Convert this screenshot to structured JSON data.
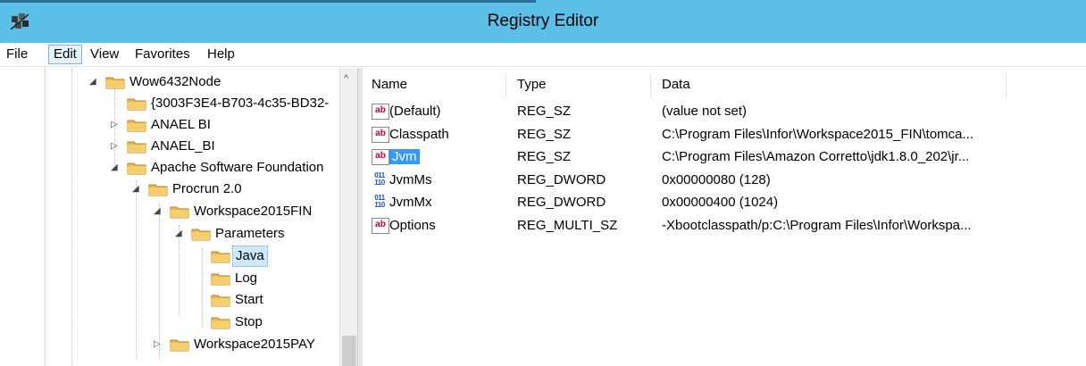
{
  "window": {
    "title": "Registry Editor"
  },
  "menu": {
    "items": [
      "File",
      "Edit",
      "View",
      "Favorites",
      "Help"
    ],
    "active": "Edit"
  },
  "tree": {
    "nodes": [
      {
        "label": "Wow6432Node",
        "state": "expanded"
      },
      {
        "label": "{3003F3E4-B703-4c35-BD32-",
        "state": "leaf"
      },
      {
        "label": "ANAEL BI",
        "state": "collapsed"
      },
      {
        "label": "ANAEL_BI",
        "state": "collapsed"
      },
      {
        "label": "Apache Software Foundation",
        "state": "expanded"
      },
      {
        "label": "Procrun 2.0",
        "state": "expanded"
      },
      {
        "label": "Workspace2015FIN",
        "state": "expanded"
      },
      {
        "label": "Parameters",
        "state": "expanded"
      },
      {
        "label": "Java",
        "state": "leaf",
        "selected": true
      },
      {
        "label": "Log",
        "state": "leaf"
      },
      {
        "label": "Start",
        "state": "leaf"
      },
      {
        "label": "Stop",
        "state": "leaf"
      },
      {
        "label": "Workspace2015PAY",
        "state": "collapsed"
      }
    ]
  },
  "list": {
    "columns": {
      "name": "Name",
      "type": "Type",
      "data": "Data"
    },
    "rows": [
      {
        "icon": "string-value-icon",
        "name": "(Default)",
        "type": "REG_SZ",
        "data": "(value not set)"
      },
      {
        "icon": "string-value-icon",
        "name": "Classpath",
        "type": "REG_SZ",
        "data": "C:\\Program Files\\Infor\\Workspace2015_FIN\\tomca..."
      },
      {
        "icon": "string-value-icon",
        "name": "Jvm",
        "type": "REG_SZ",
        "data": "C:\\Program Files\\Amazon Corretto\\jdk1.8.0_202\\jr...",
        "selected": true
      },
      {
        "icon": "binary-value-icon",
        "name": "JvmMs",
        "type": "REG_DWORD",
        "data": "0x00000080 (128)"
      },
      {
        "icon": "binary-value-icon",
        "name": "JvmMx",
        "type": "REG_DWORD",
        "data": "0x00000400 (1024)"
      },
      {
        "icon": "string-value-icon",
        "name": "Options",
        "type": "REG_MULTI_SZ",
        "data": "-Xbootclasspath/p:C:\\Program Files\\Infor\\Workspa..."
      }
    ]
  },
  "icons": {
    "ab_text": "ab",
    "bin_text": "011 110"
  }
}
